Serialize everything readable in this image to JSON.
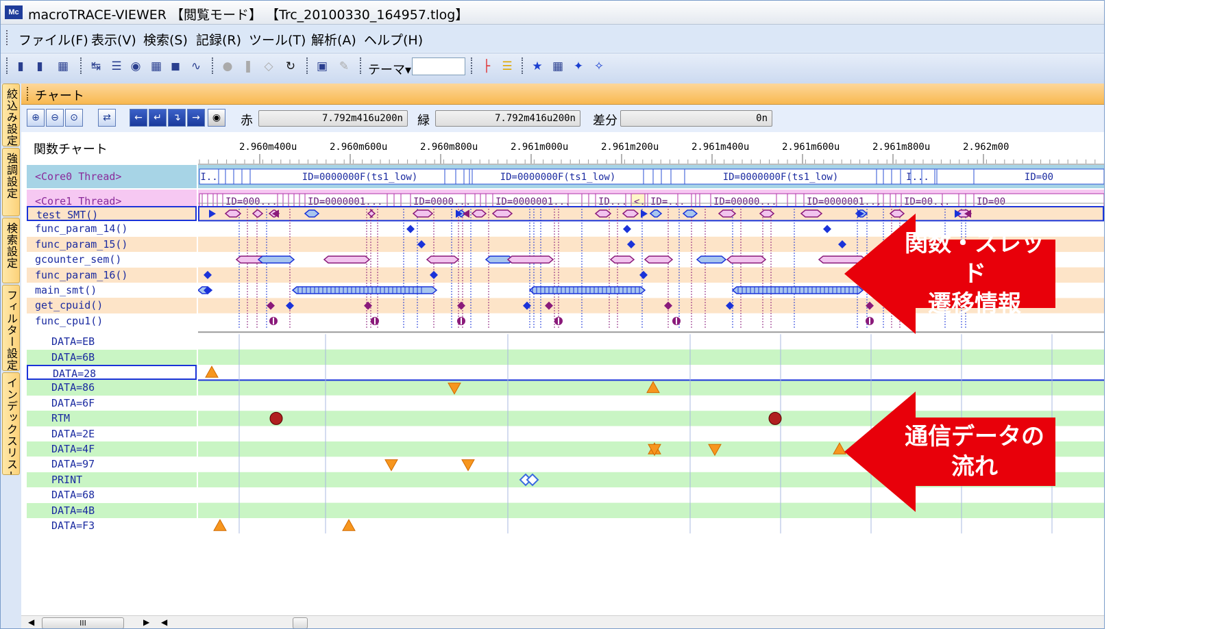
{
  "window": {
    "title": "macroTRACE-VIEWER 【閲覧モード】 【Trc_20100330_164957.tlog】",
    "logo_text": "Mc"
  },
  "menu": [
    "ファイル(F)",
    "表示(V)",
    "検索(S)",
    "記録(R)",
    "ツール(T)",
    "解析(A)",
    "ヘルプ(H)"
  ],
  "toolbar": {
    "theme_label": "テーマ▾",
    "theme_value": ""
  },
  "left_tabs": [
    "絞込み設定",
    "強調設定",
    "検索設定",
    "フィルター設定",
    "インデックスリスト"
  ],
  "panel": {
    "title": "チャート"
  },
  "chart_toolbar": {
    "red_label": "赤",
    "red_value": "7.792m416u200n",
    "green_label": "緑",
    "green_value": "7.792m416u200n",
    "diff_label": "差分",
    "diff_value": "0n"
  },
  "chart": {
    "axis_title": "関数チャート",
    "time_ticks": [
      "2.960m400u",
      "2.960m600u",
      "2.960m800u",
      "2.961m000u",
      "2.961m200u",
      "2.961m400u",
      "2.961m600u",
      "2.961m800u",
      "2.962m00"
    ],
    "threads": [
      {
        "name": "<Core0 Thread>",
        "color": "#a7d4e6",
        "segments": [
          "I..",
          "ID=0000000F(ts1_low)",
          "ID=0000000F(ts1_low)",
          "ID=0000000F(ts1_low)",
          "I...",
          "ID=00"
        ]
      },
      {
        "name": "<Core1 Thread>",
        "color": "#f6c8f2",
        "segments": [
          "ID=000...",
          "ID=0000001...",
          "ID=0000...",
          "ID=0000001...",
          "ID...",
          "<.",
          "ID=...",
          "ID=00000...",
          "ID=0000001...",
          "ID=00...",
          "ID=00"
        ]
      }
    ],
    "functions": [
      "test_SMT()",
      "func_param_14()",
      "func_param_15()",
      "gcounter_sem()",
      "func_param_16()",
      "main_smt()",
      "get_cpuid()",
      "func_cpu1()"
    ],
    "data_rows": [
      "DATA=EB",
      "DATA=6B",
      "DATA=28",
      "DATA=86",
      "DATA=6F",
      "RTM",
      "DATA=2E",
      "DATA=4F",
      "DATA=97",
      "PRINT",
      "DATA=68",
      "DATA=4B",
      "DATA=F3"
    ],
    "selected_function": "test_SMT()",
    "selected_data": "DATA=28"
  },
  "scrollbar": {
    "thumb_text": "III"
  },
  "callouts": [
    {
      "lines": [
        "関数・スレッド",
        "遷移情報"
      ]
    },
    {
      "lines": [
        "通信データの",
        "流れ"
      ]
    }
  ],
  "colors": {
    "accent_blue": "#1a33d9",
    "purple": "#8a1a7a",
    "orange": "#f7961e",
    "callout_red": "#e8000a",
    "row_band_orange": "#fde4c8",
    "row_band_green": "#c9f5c4"
  }
}
